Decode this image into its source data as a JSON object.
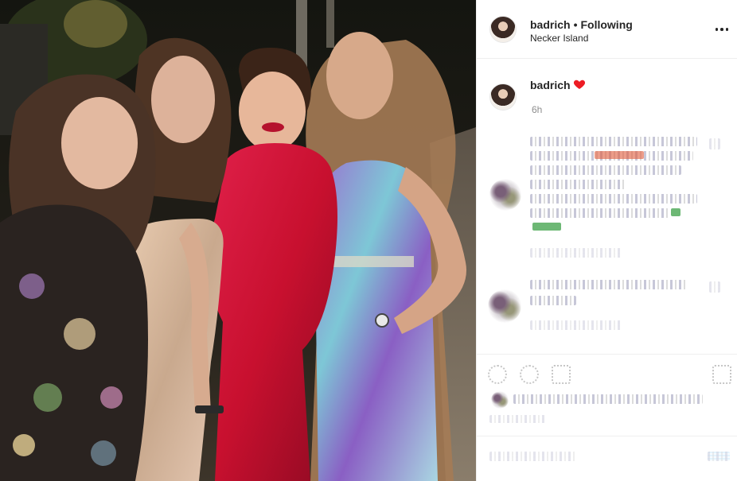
{
  "post": {
    "username": "badrich",
    "separator": "•",
    "follow_status": "Following",
    "location": "Necker Island",
    "caption_username": "badrich",
    "caption_emoji": "heart",
    "time_ago": "6h"
  },
  "icons": {
    "more": "more-options-icon",
    "heart": "red-heart-emoji",
    "like": "heart-outline-icon",
    "comment": "comment-icon",
    "share": "share-icon",
    "save": "bookmark-icon"
  },
  "colors": {
    "text": "#262626",
    "secondary_text": "#8e8e8e",
    "heart": "#ed1c24",
    "divider": "#efefef"
  }
}
